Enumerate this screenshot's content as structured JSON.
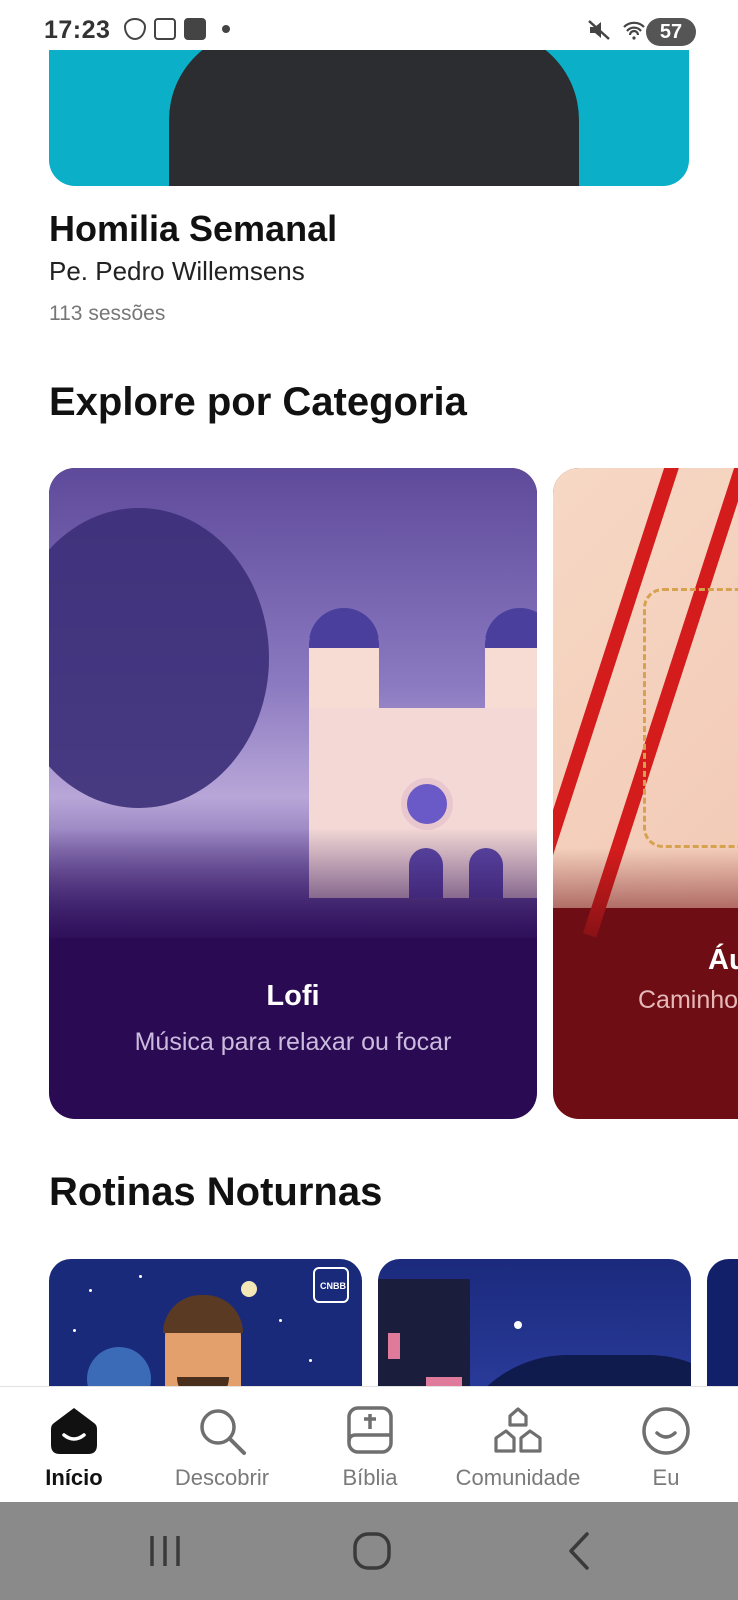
{
  "status_bar": {
    "time": "17:23",
    "battery": "57",
    "left_icons": [
      "vpn-icon",
      "key-lock-icon",
      "xp-icon",
      "notification-dot-icon"
    ],
    "right_icons": [
      "mute-icon",
      "wifi-icon",
      "signal-icon"
    ]
  },
  "featured": {
    "title": "Homilia Semanal",
    "author": "Pe. Pedro Willemsens",
    "sessions": "113 sessões"
  },
  "categories_section": {
    "title": "Explore por Categoria",
    "items": [
      {
        "name": "Lofi",
        "description": "Música para relaxar ou focar",
        "color": "#2a0a52"
      },
      {
        "name": "Áu",
        "description": "Caminho",
        "color": "#6e0e14"
      }
    ]
  },
  "routines_section": {
    "title": "Rotinas Noturnas",
    "card_logo_text": "CNBB"
  },
  "bottom_nav": {
    "items": [
      {
        "label": "Início",
        "icon": "home-icon",
        "active": true
      },
      {
        "label": "Descobrir",
        "icon": "search-icon",
        "active": false
      },
      {
        "label": "Bíblia",
        "icon": "bible-icon",
        "active": false
      },
      {
        "label": "Comunidade",
        "icon": "community-icon",
        "active": false
      },
      {
        "label": "Eu",
        "icon": "profile-icon",
        "active": false
      }
    ]
  },
  "system_nav": [
    "recent-apps-icon",
    "home-button-icon",
    "back-icon"
  ],
  "colors": {
    "banner": "#0bb0c8",
    "lofi_card": "#2a0a52",
    "audio_card": "#6e0e14",
    "system_bar": "#8a8a8a"
  }
}
